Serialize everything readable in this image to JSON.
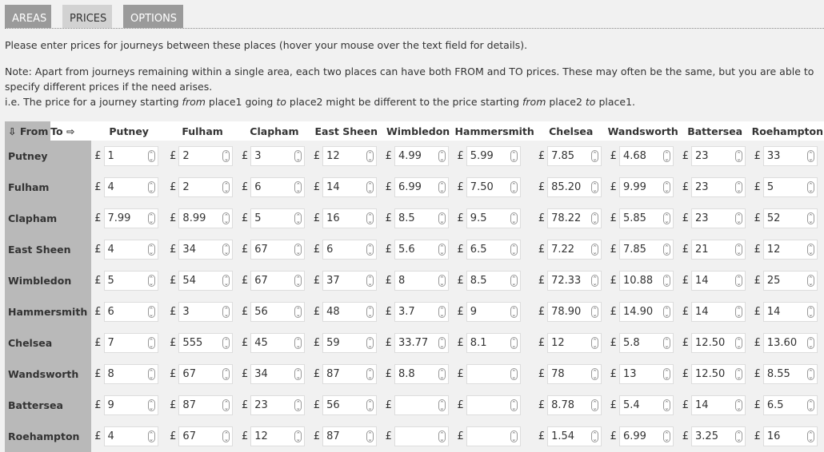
{
  "tabs": [
    {
      "label": "AREAS",
      "active": false
    },
    {
      "label": "PRICES",
      "active": true
    },
    {
      "label": "OPTIONS",
      "active": false
    }
  ],
  "intro": "Please enter prices for journeys between these places (hover your mouse over the text field for details).",
  "note": {
    "line1": "Note: Apart from journeys remaining within a single area, each two places can have both FROM and TO prices. These may often be the same, but you are able to specify different prices if the need arises.",
    "ie_prefix": "i.e. The price for a journey starting ",
    "from1": "from",
    "mid1": " place1 going ",
    "to1": "to",
    "mid2": " place2 might be different to the price starting ",
    "from2": "from",
    "mid3": " place2 ",
    "to2": "to",
    "end": " place1."
  },
  "table": {
    "corner_from": "⇩ From",
    "corner_to": "To ⇨",
    "currency": "£",
    "columns": [
      "Putney",
      "Fulham",
      "Clapham",
      "East Sheen",
      "Wimbledon",
      "Hammersmith",
      "Chelsea",
      "Wandsworth",
      "Battersea",
      "Roehampton"
    ],
    "rows": [
      {
        "name": "Putney",
        "values": [
          "1",
          "2",
          "3",
          "12",
          "4.99",
          "5.99",
          "7.85",
          "4.68",
          "23",
          "33"
        ]
      },
      {
        "name": "Fulham",
        "values": [
          "4",
          "2",
          "6",
          "14",
          "6.99",
          "7.50",
          "85.20",
          "9.99",
          "23",
          "5"
        ]
      },
      {
        "name": "Clapham",
        "values": [
          "7.99",
          "8.99",
          "5",
          "16",
          "8.5",
          "9.5",
          "78.22",
          "5.85",
          "23",
          "52"
        ]
      },
      {
        "name": "East Sheen",
        "values": [
          "4",
          "34",
          "67",
          "6",
          "5.6",
          "6.5",
          "7.22",
          "7.85",
          "21",
          "12"
        ]
      },
      {
        "name": "Wimbledon",
        "values": [
          "5",
          "54",
          "67",
          "37",
          "8",
          "8.5",
          "72.33",
          "10.88",
          "14",
          "25"
        ]
      },
      {
        "name": "Hammersmith",
        "values": [
          "6",
          "3",
          "56",
          "48",
          "3.7",
          "9",
          "78.90",
          "14.90",
          "14",
          "14"
        ]
      },
      {
        "name": "Chelsea",
        "values": [
          "7",
          "555",
          "45",
          "59",
          "33.77",
          "8.1",
          "12",
          "5.8",
          "12.50",
          "13.60"
        ]
      },
      {
        "name": "Wandsworth",
        "values": [
          "8",
          "67",
          "34",
          "87",
          "8.8",
          "",
          "78",
          "13",
          "12.50",
          "8.55"
        ]
      },
      {
        "name": "Battersea",
        "values": [
          "9",
          "87",
          "23",
          "56",
          "",
          "",
          "8.78",
          "5.4",
          "14",
          "6.5"
        ]
      },
      {
        "name": "Roehampton",
        "values": [
          "4",
          "67",
          "12",
          "87",
          "",
          "",
          "1.54",
          "6.99",
          "3.25",
          "16"
        ]
      }
    ]
  }
}
